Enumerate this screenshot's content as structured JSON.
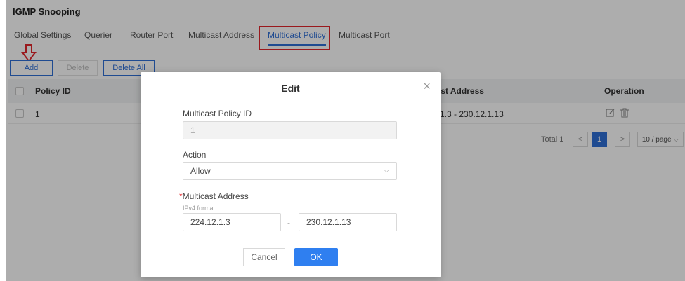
{
  "app": {
    "title": "IGMP Snooping"
  },
  "tabs": [
    {
      "label": "Global Settings"
    },
    {
      "label": "Querier"
    },
    {
      "label": "Router Port"
    },
    {
      "label": "Multicast Address"
    },
    {
      "label": "Multicast Policy",
      "active": true
    },
    {
      "label": "Multicast Port"
    }
  ],
  "toolbar": {
    "add": "Add",
    "delete": "Delete",
    "delete_all": "Delete All"
  },
  "table": {
    "columns": [
      "Policy ID",
      "ıst Address",
      "Operation"
    ],
    "rows": [
      {
        "id": "1",
        "address": "1.3 - 230.12.1.13"
      }
    ]
  },
  "pagination": {
    "total": "Total 1",
    "prev": "<",
    "page": "1",
    "next": ">",
    "page_size": "10 / page"
  },
  "modal": {
    "title": "Edit",
    "close": "×",
    "policy_id_label": "Multicast Policy ID",
    "policy_id_value": "1",
    "action_label": "Action",
    "action_value": "Allow",
    "address_required": "*",
    "address_label": "Multicast Address",
    "address_hint": "IPv4 format",
    "address_start": "224.12.1.3",
    "address_separator": "-",
    "address_end": "230.12.1.13",
    "cancel": "Cancel",
    "ok": "OK"
  },
  "colors": {
    "accent": "#2f6fd6",
    "highlight": "#e3262b",
    "ok_button": "#2f7ff0"
  }
}
